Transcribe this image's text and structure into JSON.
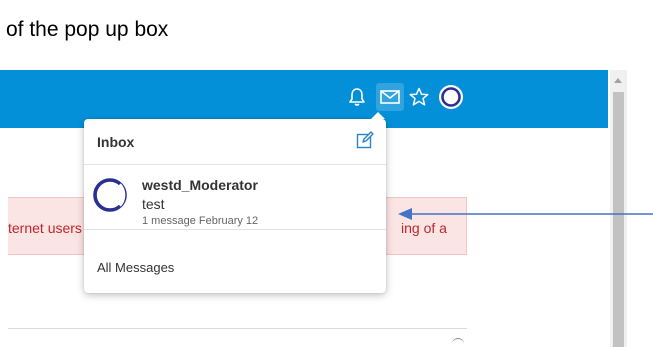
{
  "doc": {
    "line1": "",
    "line2": "of the pop up box"
  },
  "alert": {
    "left_fragment": "ternet users",
    "right_fragment": "ing of a"
  },
  "popup": {
    "title": "Inbox",
    "message": {
      "sender": "westd_Moderator",
      "preview": "test",
      "meta": "1 message  February 12"
    },
    "all_messages_label": "All Messages"
  },
  "icons": {
    "bell": "bell-icon",
    "mail": "mail-icon",
    "star": "star-icon",
    "avatar": "avatar",
    "compose": "compose-icon"
  },
  "colors": {
    "topbar": "#0490d8",
    "alert_bg": "#fbe4e4",
    "alert_text": "#c0272d",
    "annotation_arrow": "#4472c4"
  }
}
